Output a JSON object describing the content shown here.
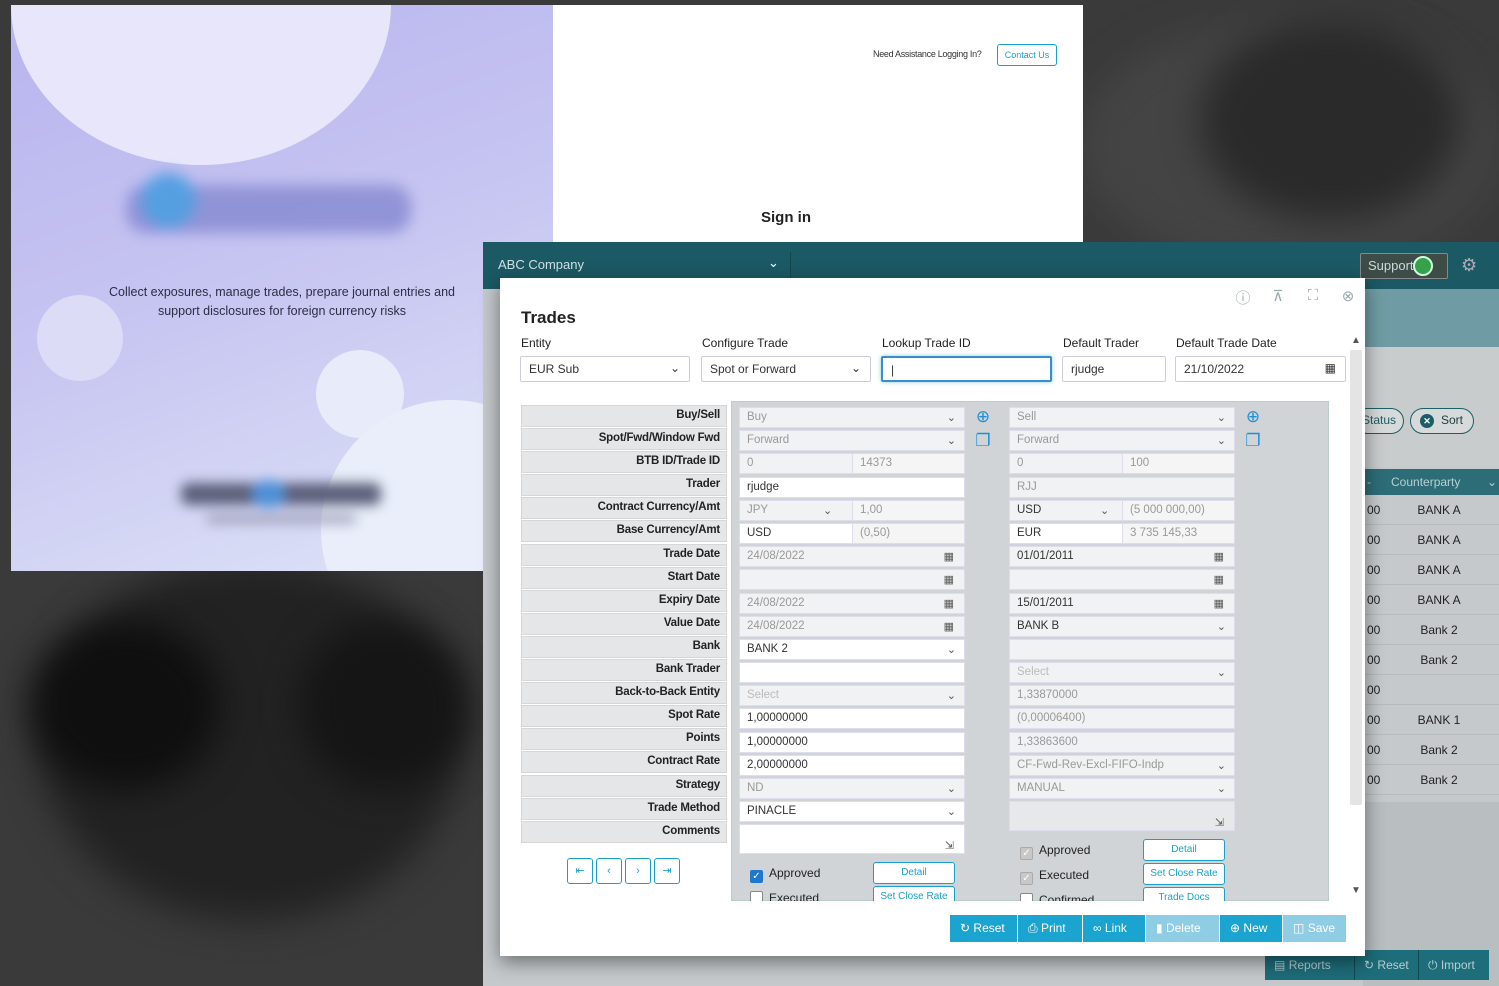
{
  "login": {
    "tagline": "Collect exposures, manage trades, prepare journal entries and support disclosures for foreign currency risks",
    "assist_text": "Need Assistance Logging In?",
    "contact_label": "Contact Us",
    "signin_title": "Sign in"
  },
  "app": {
    "company": "ABC Company",
    "support_label": "Support",
    "status_label": "Status",
    "sort_label": "Sort",
    "grid_headers": {
      "col_a": "-",
      "counterparty": "Counterparty"
    },
    "grid_rows": [
      {
        "a": "00",
        "cp": "BANK A"
      },
      {
        "a": "00",
        "cp": "BANK A"
      },
      {
        "a": "00",
        "cp": "BANK A"
      },
      {
        "a": "00",
        "cp": "BANK A"
      },
      {
        "a": "00",
        "cp": "Bank 2"
      },
      {
        "a": "00",
        "cp": "Bank 2"
      },
      {
        "a": "00",
        "cp": ""
      },
      {
        "a": "00",
        "cp": "BANK 1"
      },
      {
        "a": "00",
        "cp": "Bank 2"
      },
      {
        "a": "00",
        "cp": "Bank 2"
      }
    ],
    "bottom_buttons": {
      "reports": "Reports",
      "reset": "Reset",
      "import": "Import"
    }
  },
  "dialog": {
    "title": "Trades",
    "entity_label": "Entity",
    "entity_value": "EUR Sub",
    "configure_label": "Configure Trade",
    "configure_value": "Spot or Forward",
    "lookup_label": "Lookup Trade ID",
    "lookup_value": "",
    "default_trader_label": "Default Trader",
    "default_trader_value": "rjudge",
    "default_date_label": "Default Trade Date",
    "default_date_value": "21/10/2022",
    "field_labels": [
      "Buy/Sell",
      "Spot/Fwd/Window Fwd",
      "BTB ID/Trade ID",
      "Trader",
      "Contract Currency/Amt",
      "Base Currency/Amt",
      "Trade Date",
      "Start Date",
      "Expiry Date",
      "Value Date",
      "Bank",
      "Bank Trader",
      "Back-to-Back Entity",
      "Spot Rate",
      "Points",
      "Contract Rate",
      "Strategy",
      "Trade Method",
      "Comments"
    ],
    "trade1": {
      "buy_sell": "Buy",
      "spot_fwd": "Forward",
      "btb_id": "0",
      "trade_id": "14373",
      "trader": "rjudge",
      "contract_ccy": "JPY",
      "contract_amt": "1,00",
      "base_ccy": "USD",
      "base_amt": "(0,50)",
      "trade_date": "24/08/2022",
      "start_date": "",
      "expiry_date": "24/08/2022",
      "value_date": "24/08/2022",
      "bank": "BANK 2",
      "bank_trader": "",
      "btb_entity": "Select",
      "spot_rate": "1,00000000",
      "points": "1,00000000",
      "contract_rate": "2,00000000",
      "strategy": "ND",
      "trade_method": "PINACLE",
      "approved": "Approved",
      "executed": "Executed",
      "detail": "Detail",
      "set_close_rate": "Set Close Rate"
    },
    "trade2": {
      "buy_sell": "Sell",
      "spot_fwd": "Forward",
      "btb_id": "0",
      "trade_id": "100",
      "trader": "RJJ",
      "contract_ccy": "USD",
      "contract_amt": "(5 000 000,00)",
      "base_ccy": "EUR",
      "base_amt": "3 735 145,33",
      "trade_date": "01/01/2011",
      "start_date": "",
      "expiry_date": "15/01/2011",
      "value_date": "BANK B",
      "bank": "",
      "bank_trader": "Select",
      "btb_entity": "1,33870000",
      "spot_rate": "(0,00006400)",
      "points": "1,33863600",
      "contract_rate": "CF-Fwd-Rev-Excl-FIFO-Indp",
      "strategy": "MANUAL",
      "approved": "Approved",
      "executed": "Executed",
      "confirmed": "Confirmed",
      "detail": "Detail",
      "set_close_rate": "Set Close Rate",
      "trade_docs": "Trade Docs"
    },
    "actions": {
      "reset": "Reset",
      "print": "Print",
      "link": "Link",
      "delete": "Delete",
      "new": "New",
      "save": "Save"
    }
  }
}
